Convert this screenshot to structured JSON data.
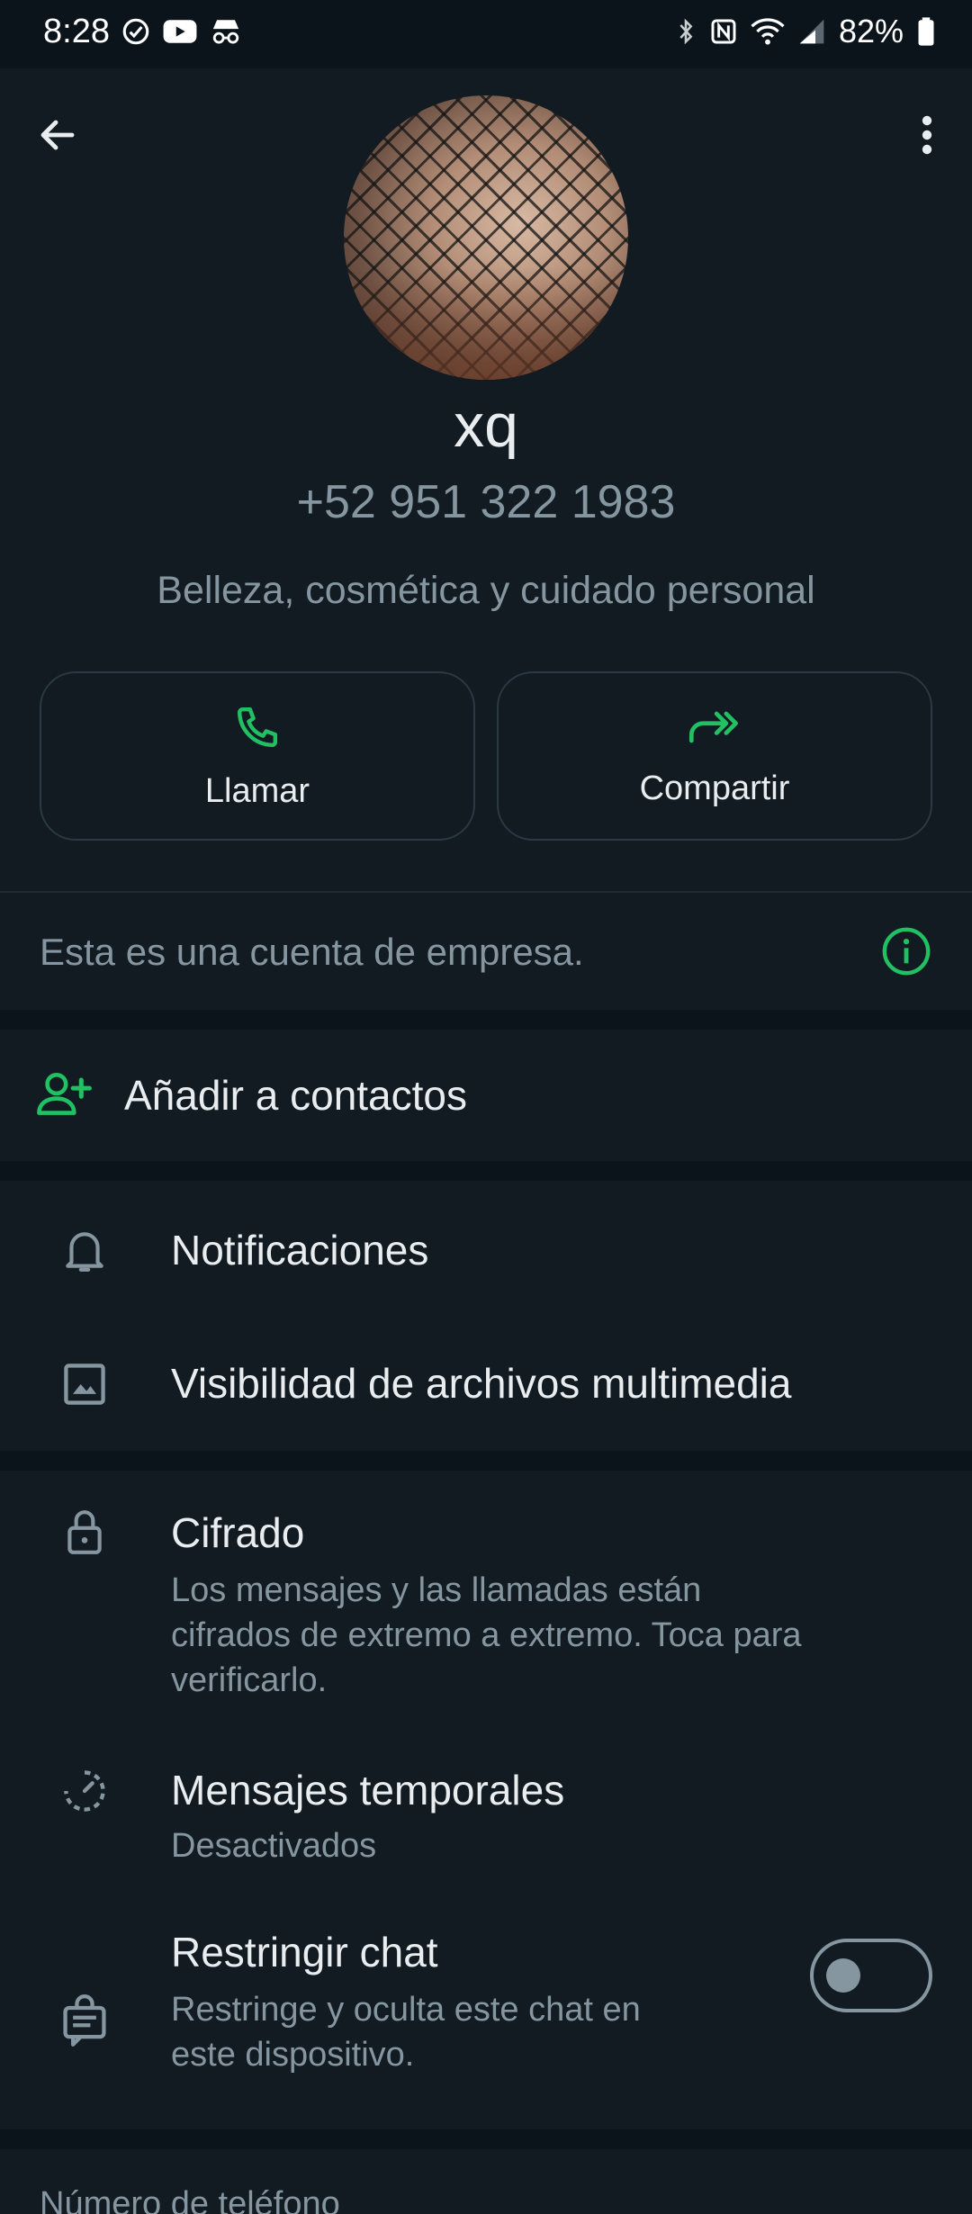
{
  "status_bar": {
    "time": "8:28",
    "battery": "82%",
    "icons": [
      "check-circle-icon",
      "youtube-icon",
      "incognito-icon",
      "bluetooth-icon",
      "nfc-icon",
      "wifi-icon",
      "signal-icon",
      "battery-icon"
    ]
  },
  "header": {
    "back_icon": "arrow-left-icon",
    "more_icon": "more-vert-icon"
  },
  "profile": {
    "name": "xq",
    "phone": "+52 951 322 1983",
    "category": "Belleza, cosmética y cuidado personal"
  },
  "actions": {
    "call_label": "Llamar",
    "share_label": "Compartir"
  },
  "business_notice": {
    "text": "Esta es una cuenta de empresa."
  },
  "add_contact": {
    "label": "Añadir a contactos"
  },
  "settings_group1": {
    "notifications": "Notificaciones",
    "media_visibility": "Visibilidad de archivos multimedia"
  },
  "settings_group2": {
    "encryption_title": "Cifrado",
    "encryption_line1": "Los mensajes y las llamadas están",
    "encryption_line2": "cifrados de extremo a extremo. Toca para",
    "encryption_line3": "verificarlo.",
    "disappearing_title": "Mensajes temporales",
    "disappearing_sub": "Desactivados",
    "restrict_title": "Restringir chat",
    "restrict_line1": "Restringe y oculta este chat en",
    "restrict_line2": "este dispositivo.",
    "restrict_enabled": false
  },
  "phone_section": {
    "title": "Número de teléfono"
  },
  "colors": {
    "background": "#0b141a",
    "panel": "#111b21",
    "accent_green": "#21c063",
    "primary_text": "#e9edef",
    "secondary_text": "#8696a0"
  }
}
